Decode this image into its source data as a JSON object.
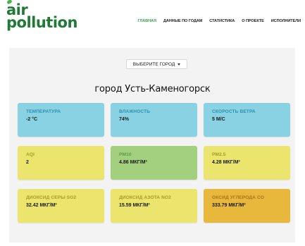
{
  "logo": {
    "line1": "air",
    "line2": "pollution"
  },
  "nav": [
    {
      "label": "ГЛАВНАЯ",
      "active": true
    },
    {
      "label": "ДАННЫЕ ПО ГОДАМ",
      "active": false
    },
    {
      "label": "СТАТИСТИКА",
      "active": false
    },
    {
      "label": "О ПРОЕКТЕ",
      "active": false
    },
    {
      "label": "ИСПОЛНИТЕЛИ",
      "active": false
    }
  ],
  "city_select": {
    "label": "ВЫБЕРИТЕ ГОРОД"
  },
  "city_title": "город Усть-Каменогорск",
  "cards": [
    {
      "label": "ТЕМПЕРАТУРА",
      "value": "-2 °C",
      "color": "#89d2e4"
    },
    {
      "label": "ВЛАЖНОСТЬ",
      "value": "74%",
      "color": "#89d2e4"
    },
    {
      "label": "СКОРОСТЬ ВЕТРА",
      "value": "5 М/С",
      "color": "#89d2e4"
    },
    {
      "label": "AQI",
      "value": "2",
      "color": "#ebe46d"
    },
    {
      "label": "PM10",
      "value": "4.86 МКГ/М³",
      "color": "#a3d07f"
    },
    {
      "label": "PM2.5",
      "value": "4.28 МКГ/М³",
      "color": "#ebe46d"
    },
    {
      "label": "ДИОКСИД СЕРЫ SO2",
      "value": "32.42 МКГ/М³",
      "color": "#ebe46d"
    },
    {
      "label": "ДИОКСИД АЗОТА NO2",
      "value": "15.59 МКГ/М³",
      "color": "#ebe46d"
    },
    {
      "label": "ОКСИД УГЛЕРОДА CO",
      "value": "333.79 МКГ/М³",
      "color": "#e8b83d"
    }
  ]
}
